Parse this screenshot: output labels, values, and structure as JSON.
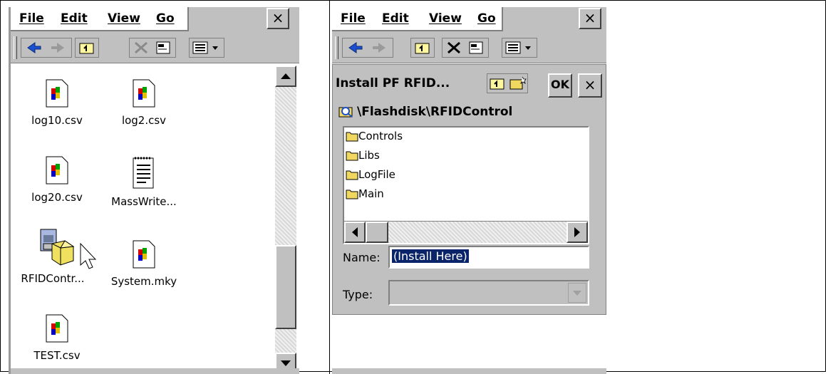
{
  "left_window": {
    "menu": [
      "File",
      "Edit",
      "View",
      "Go"
    ],
    "close_label": "×",
    "files": [
      {
        "name": "log10.csv",
        "icon": "spreadsheet-file-icon"
      },
      {
        "name": "log2.csv",
        "icon": "spreadsheet-file-icon"
      },
      {
        "name": "log20.csv",
        "icon": "spreadsheet-file-icon"
      },
      {
        "name": "MassWrite...",
        "icon": "text-document-icon"
      },
      {
        "name": "RFIDContr...",
        "icon": "installer-package-icon"
      },
      {
        "name": "System.mky",
        "icon": "spreadsheet-file-icon"
      },
      {
        "name": "TEST.csv",
        "icon": "spreadsheet-file-icon"
      }
    ]
  },
  "right_window": {
    "menu": [
      "File",
      "Edit",
      "View",
      "Go"
    ],
    "close_label": "×",
    "dialog": {
      "title": "Install PF RFID...",
      "ok_label": "OK",
      "close_label": "×",
      "path": "\\Flashdisk\\RFIDControl",
      "folders": [
        "Controls",
        "Libs",
        "LogFile",
        "Main"
      ],
      "name_label": "Name:",
      "name_value": "(Install Here)",
      "type_label": "Type:",
      "type_value": ""
    }
  },
  "colors": {
    "window_gray": "#c0c0c0",
    "selection": "#0a246a"
  }
}
